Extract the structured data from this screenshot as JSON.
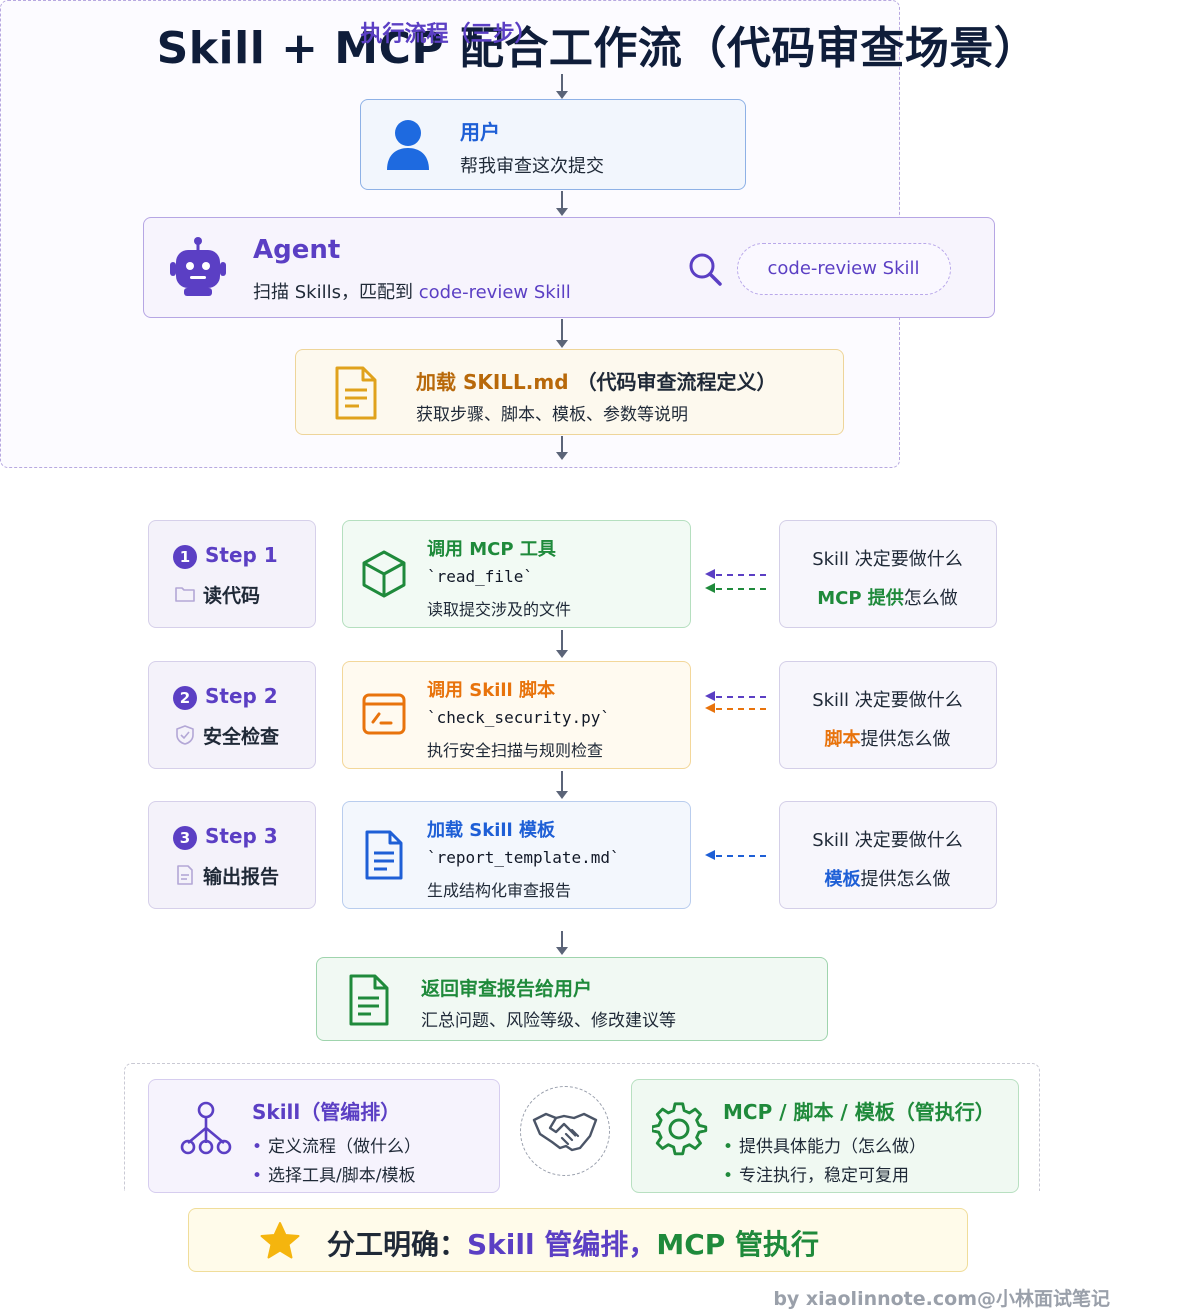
{
  "title": "Skill + MCP 配合工作流（代码审查场景）",
  "user": {
    "label": "用户",
    "text": "帮我审查这次提交"
  },
  "agent": {
    "label": "Agent",
    "text_prefix": "扫描 Skills，匹配到 ",
    "text_highlight": "code-review Skill",
    "pill": "code-review Skill"
  },
  "skill_md": {
    "title_prefix": "加载 SKILL.md",
    "title_suffix": "（代码审查流程定义）",
    "desc": "获取步骤、脚本、模板、参数等说明"
  },
  "exec": {
    "heading": "执行流程（三步）",
    "steps": [
      {
        "num": "1",
        "step": "Step 1",
        "name": "读代码",
        "action": "调用 MCP 工具",
        "code": "`read_file`",
        "desc": "读取提交涉及的文件",
        "right_top": "Skill 决定要做什么",
        "right_hl": "MCP 提供",
        "right_rest": "怎么做"
      },
      {
        "num": "2",
        "step": "Step 2",
        "name": "安全检查",
        "action": "调用 Skill 脚本",
        "code": "`check_security.py`",
        "desc": "执行安全扫描与规则检查",
        "right_top": "Skill 决定要做什么",
        "right_hl": "脚本",
        "right_rest": "提供怎么做"
      },
      {
        "num": "3",
        "step": "Step 3",
        "name": "输出报告",
        "action": "加载 Skill 模板",
        "code": "`report_template.md`",
        "desc": "生成结构化审查报告",
        "right_top": "Skill 决定要做什么",
        "right_hl": "模板",
        "right_rest": "提供怎么做"
      }
    ]
  },
  "return": {
    "title": "返回审查报告给用户",
    "desc": "汇总问题、风险等级、修改建议等"
  },
  "roles": {
    "skill": {
      "title": "Skill（管编排）",
      "items": [
        "定义流程（做什么）",
        "选择工具/脚本/模板"
      ]
    },
    "mcp": {
      "title": "MCP / 脚本 / 模板（管执行）",
      "items": [
        "提供具体能力（怎么做）",
        "专注执行，稳定可复用"
      ]
    }
  },
  "banner": {
    "prefix": "分工明确：",
    "skill_part": "Skill 管编排，",
    "mcp_part": "MCP 管执行"
  },
  "watermark": "by xiaolinnote.com@小林面试笔记",
  "colors": {
    "purple": "#5b3fc4",
    "blue": "#1e5fd6",
    "green": "#1f8a3b",
    "orange": "#e8730c",
    "brown": "#b8690a",
    "navy": "#0f1d3a"
  }
}
